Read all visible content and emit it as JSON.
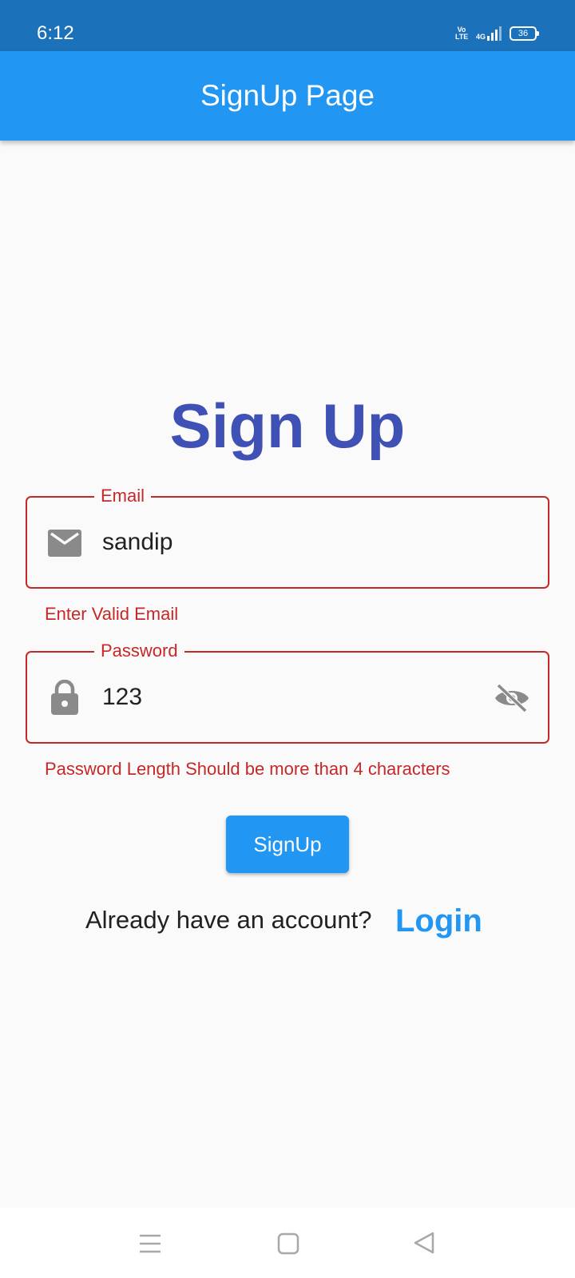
{
  "status_bar": {
    "time": "6:12",
    "volte_line1": "Vo",
    "volte_line2": "LTE",
    "network": "4G",
    "battery": "36",
    "color": "#1b72bb"
  },
  "app_bar": {
    "title": "SignUp Page",
    "color": "#2196f3"
  },
  "form": {
    "heading": "Sign Up",
    "heading_color": "#3f51b5",
    "email": {
      "label": "Email",
      "value": "sandip",
      "error": "Enter Valid Email",
      "icon": "mail-icon"
    },
    "password": {
      "label": "Password",
      "value": "123",
      "error": "Password Length Should be more than 4 characters",
      "icon": "lock-icon",
      "toggle_icon": "visibility-off-icon"
    },
    "error_color": "#c62828",
    "submit_label": "SignUp",
    "account_prompt": "Already have an account?",
    "login_label": "Login"
  },
  "nav_bar": {
    "icons": [
      "menu-icon",
      "home-square-icon",
      "back-triangle-icon"
    ]
  }
}
